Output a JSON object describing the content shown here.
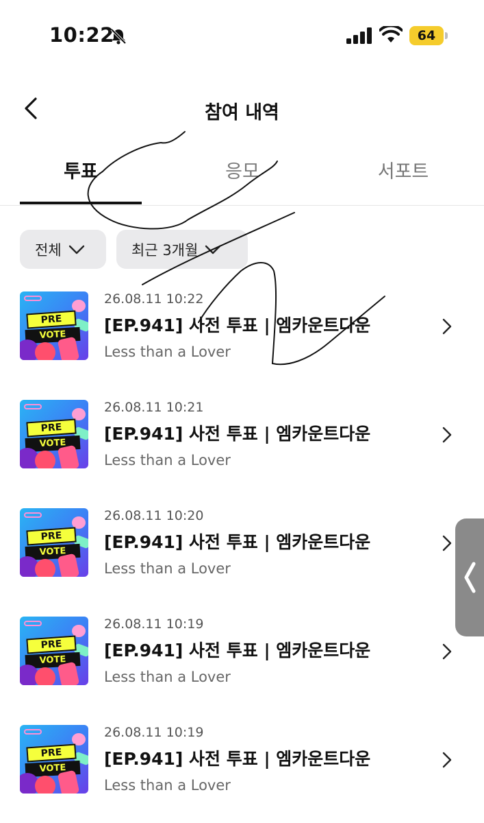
{
  "status_bar": {
    "time": "10:22",
    "battery": "64"
  },
  "header": {
    "title": "참여 내역"
  },
  "tabs": [
    {
      "label": "투표",
      "active": true
    },
    {
      "label": "응모",
      "active": false
    },
    {
      "label": "서포트",
      "active": false
    }
  ],
  "filters": [
    {
      "label": "전체"
    },
    {
      "label": "최근 3개월"
    }
  ],
  "items": [
    {
      "thumb_pre": "PRE",
      "thumb_vote": "VOTE",
      "date": "26.08.11 10:22",
      "title": "[EP.941] 사전 투표 | 엠카운트다운",
      "subtitle": "Less than a Lover"
    },
    {
      "thumb_pre": "PRE",
      "thumb_vote": "VOTE",
      "date": "26.08.11 10:21",
      "title": "[EP.941] 사전 투표 | 엠카운트다운",
      "subtitle": "Less than a Lover"
    },
    {
      "thumb_pre": "PRE",
      "thumb_vote": "VOTE",
      "date": "26.08.11 10:20",
      "title": "[EP.941] 사전 투표 | 엠카운트다운",
      "subtitle": "Less than a Lover"
    },
    {
      "thumb_pre": "PRE",
      "thumb_vote": "VOTE",
      "date": "26.08.11 10:19",
      "title": "[EP.941] 사전 투표 | 엠카운트다운",
      "subtitle": "Less than a Lover"
    },
    {
      "thumb_pre": "PRE",
      "thumb_vote": "VOTE",
      "date": "26.08.11 10:19",
      "title": "[EP.941] 사전 투표 | 엠카운트다운",
      "subtitle": "Less than a Lover"
    }
  ],
  "colors": {
    "battery": "#f5cc2c",
    "filter_bg": "#eaeaec",
    "tab_active": "#111111",
    "side_handle": "#8a8a8a"
  },
  "icons": {
    "back": "chevron-left-icon",
    "bell": "bell-off-icon",
    "signal": "cellular-signal-icon",
    "wifi": "wifi-icon",
    "filter": "chevron-down-icon",
    "item": "chevron-right-icon",
    "handle": "chevron-left-icon"
  }
}
